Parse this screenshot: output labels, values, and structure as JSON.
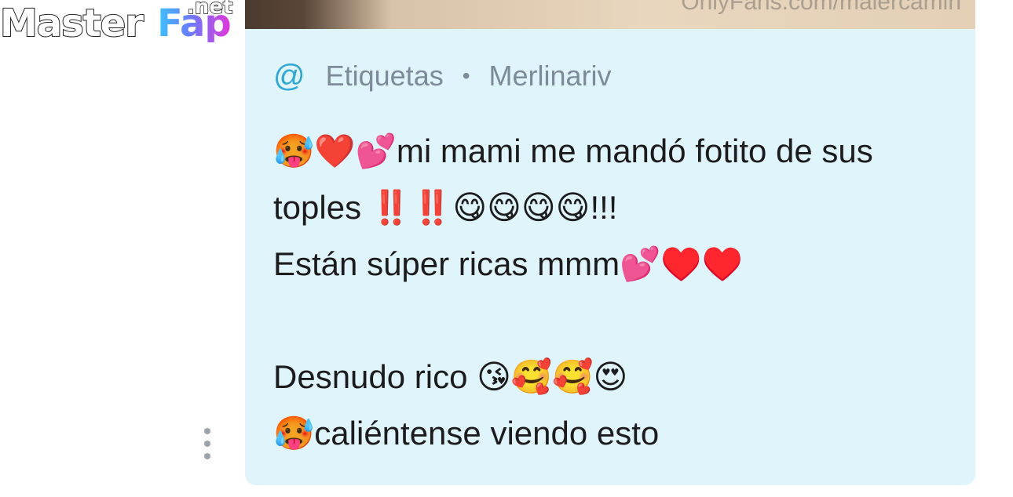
{
  "logo": {
    "part1": "Master",
    "part2": "Fap",
    "tld": ".net"
  },
  "photo": {
    "watermark": "OnlyFans.com/malercamin"
  },
  "post": {
    "mention_icon": "@",
    "tag_label": "Etiquetas",
    "separator": "•",
    "author": "Merlinariv",
    "body": "🥵❤️💕mi mami me mandó fotito de sus toples ‼️‼️😋😋😋😋!!!\nEstán súper ricas mmm💕♥️♥️\n\nDesnudo rico 😘🥰🥰😍\n🥵caliéntense viendo esto"
  },
  "icons": {
    "more": "more-vertical-icon",
    "mention": "at-icon"
  },
  "colors": {
    "card_bg": "#dff4fb",
    "accent": "#2fa8d6",
    "meta_text": "#7d8a99",
    "body_text": "#1c1c1e"
  }
}
